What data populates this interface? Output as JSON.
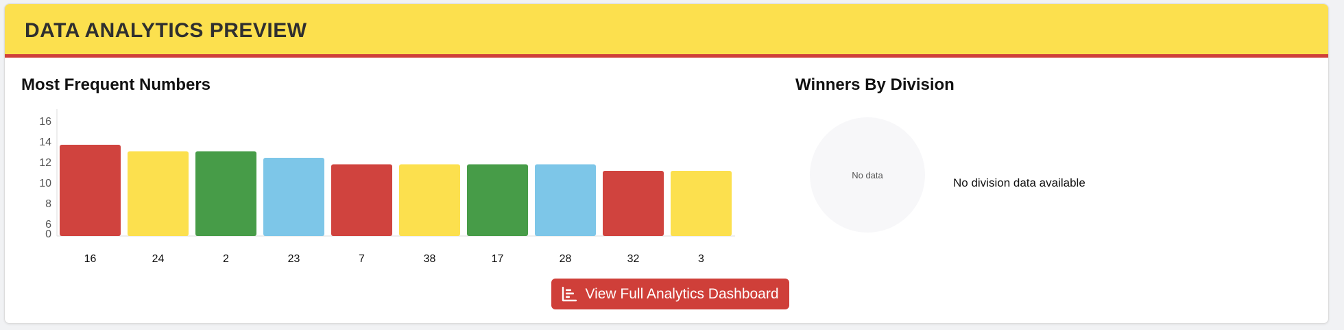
{
  "header": {
    "title": "DATA ANALYTICS PREVIEW"
  },
  "frequent": {
    "title": "Most Frequent Numbers",
    "chart_data": {
      "type": "bar",
      "categories": [
        "16",
        "24",
        "2",
        "23",
        "7",
        "38",
        "17",
        "28",
        "32",
        "3"
      ],
      "values": [
        14,
        13,
        13,
        12,
        11,
        11,
        11,
        11,
        10,
        10
      ],
      "yticks": [
        "16",
        "14",
        "12",
        "10",
        "8",
        "6",
        "0"
      ],
      "bar_colors": [
        "#d0433e",
        "#fce04e",
        "#479c48",
        "#7dc6e8",
        "#d0433e",
        "#fce04e",
        "#479c48",
        "#7dc6e8",
        "#d0433e",
        "#fce04e"
      ],
      "grid": false,
      "title": "",
      "xlabel": "",
      "ylabel": ""
    }
  },
  "division": {
    "title": "Winners By Division",
    "pie_empty_label": "No data",
    "message": "No division data available"
  },
  "cta": {
    "label": "View Full Analytics Dashboard",
    "icon": "chart-bar-icon"
  },
  "colors": {
    "header_bg": "#fce04e",
    "header_border": "#cf3f39",
    "button_bg": "#cf3f39"
  }
}
